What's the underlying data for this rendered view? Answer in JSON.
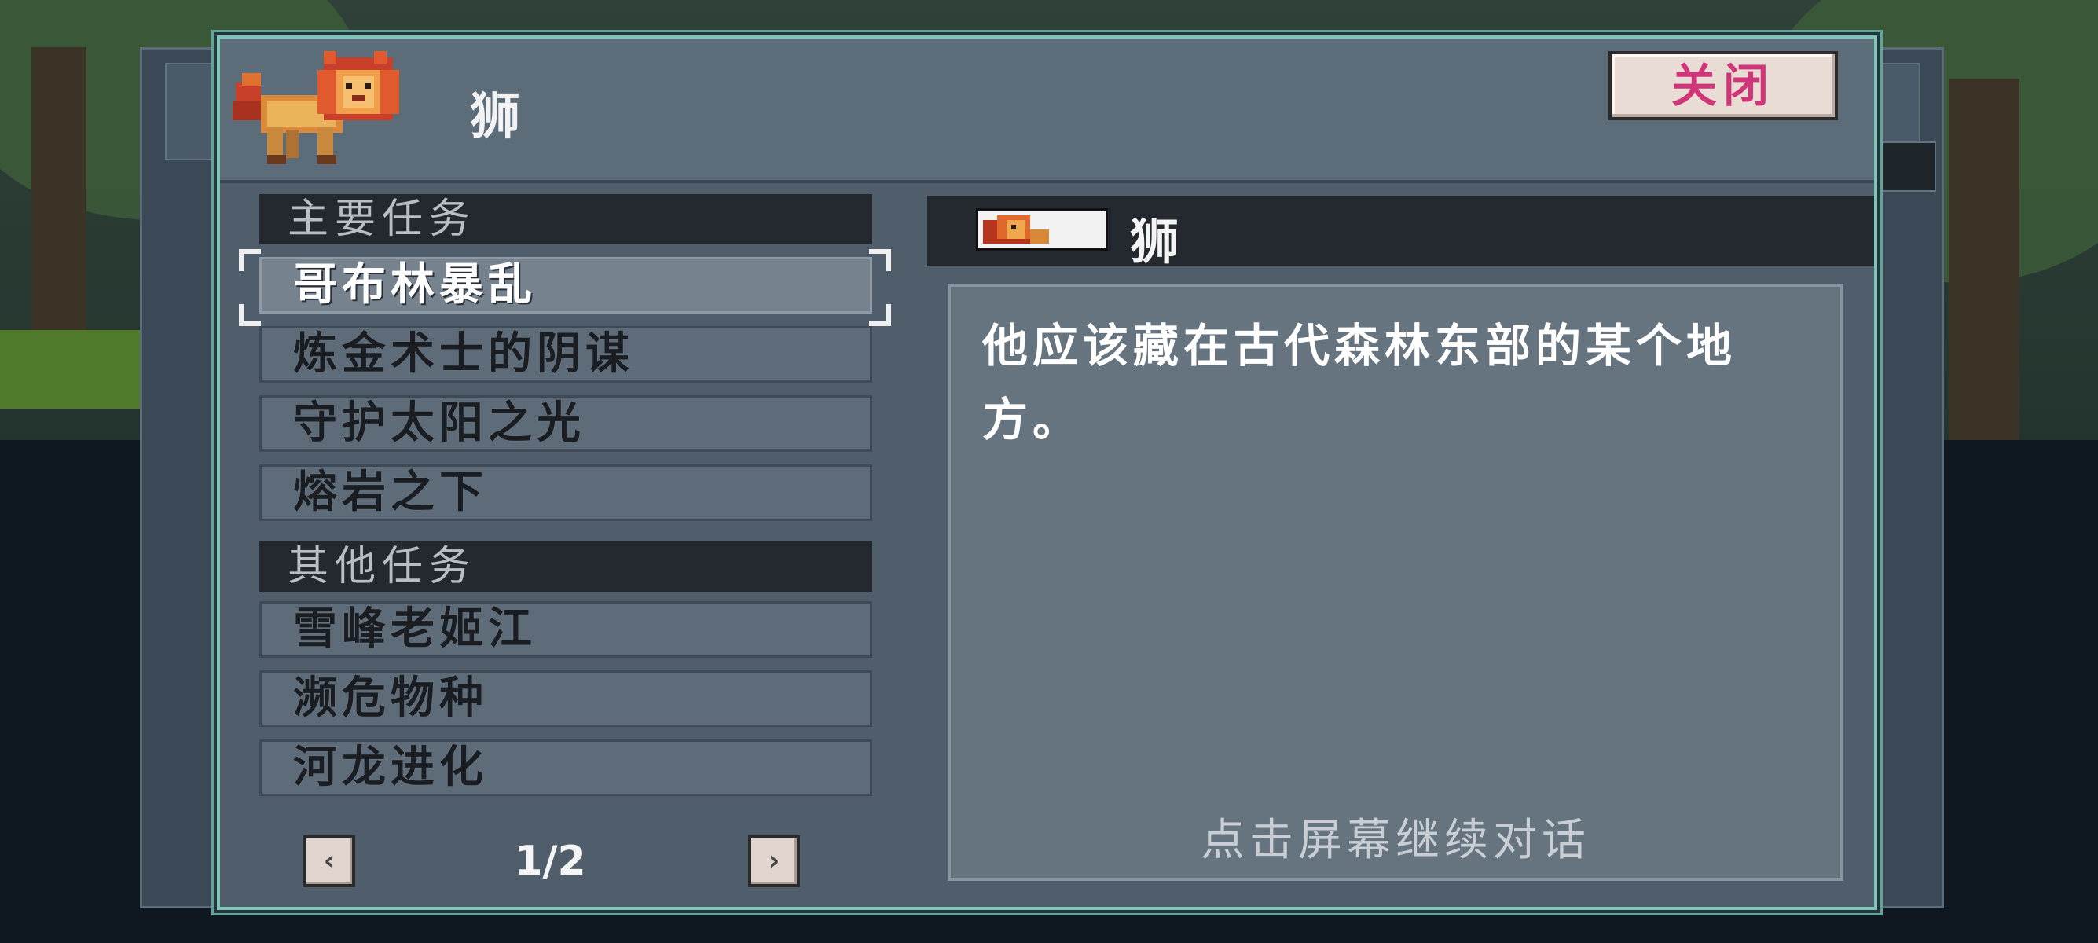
{
  "npc": {
    "name": "狮"
  },
  "close_button": {
    "label": "关闭"
  },
  "quest_list": {
    "main_header": "主要任务",
    "main_quests": [
      {
        "label": "哥布林暴乱"
      },
      {
        "label": "炼金术士的阴谋"
      },
      {
        "label": "守护太阳之光"
      },
      {
        "label": "熔岩之下"
      }
    ],
    "other_header": "其他任务",
    "other_quests": [
      {
        "label": "雪峰老姬江"
      },
      {
        "label": "濒危物种"
      },
      {
        "label": "河龙进化"
      }
    ],
    "selected_index": 0
  },
  "pager": {
    "label": "1/2",
    "prev_icon": "chevron-left-icon",
    "next_icon": "chevron-right-icon"
  },
  "detail": {
    "name": "狮",
    "description": "他应该藏在古代森林东部的某个地方。",
    "continue_hint": "点击屏幕继续对话"
  },
  "colors": {
    "dialog_border": "#7fc4b8",
    "close_text": "#d0357a",
    "panel_bg": "#505e6b"
  }
}
